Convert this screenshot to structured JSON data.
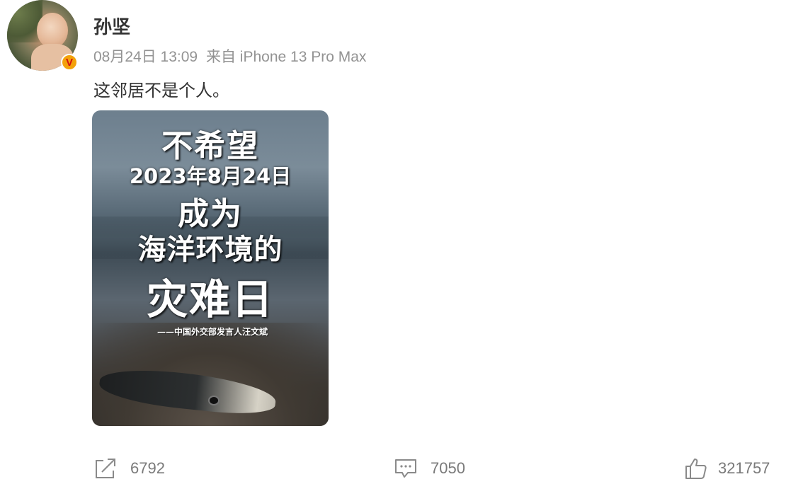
{
  "user": {
    "name": "孙坚",
    "verified_badge": "V",
    "avatar_icon": "avatar-photo"
  },
  "post": {
    "date": "08月24日 13:09",
    "source": "来自 iPhone 13 Pro Max",
    "text": "这邻居不是个人。"
  },
  "image": {
    "line1": "不希望",
    "line2": "2023年8月24日",
    "line3": "成为",
    "line4": "海洋环境的",
    "line5": "灾难日",
    "credit": "——中国外交部发言人汪文斌"
  },
  "actions": {
    "repost_count": "6792",
    "comment_count": "7050",
    "like_count": "321757"
  },
  "colors": {
    "badge": "#f3a10a",
    "badge_text": "#d4140f",
    "meta_text": "#939393",
    "action_text": "#7a7a7a"
  }
}
